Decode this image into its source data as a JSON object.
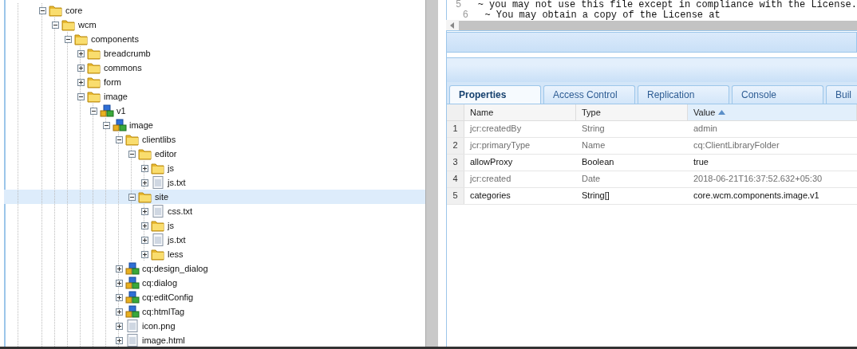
{
  "tree": [
    {
      "label": "core",
      "kind": "folder",
      "expanded": true,
      "selected": false,
      "children": [
        {
          "label": "wcm",
          "kind": "folder",
          "expanded": true,
          "selected": false,
          "children": [
            {
              "label": "components",
              "kind": "folder",
              "expanded": true,
              "selected": false,
              "children": [
                {
                  "label": "breadcrumb",
                  "kind": "folder",
                  "expanded": false,
                  "selected": false
                },
                {
                  "label": "commons",
                  "kind": "folder",
                  "expanded": false,
                  "selected": false
                },
                {
                  "label": "form",
                  "kind": "folder",
                  "expanded": false,
                  "selected": false
                },
                {
                  "label": "image",
                  "kind": "folder",
                  "expanded": true,
                  "selected": false,
                  "children": [
                    {
                      "label": "v1",
                      "kind": "component",
                      "expanded": true,
                      "selected": false,
                      "children": [
                        {
                          "label": "image",
                          "kind": "component",
                          "expanded": true,
                          "selected": false,
                          "children": [
                            {
                              "label": "clientlibs",
                              "kind": "folder",
                              "expanded": true,
                              "selected": false,
                              "children": [
                                {
                                  "label": "editor",
                                  "kind": "folder",
                                  "expanded": true,
                                  "selected": false,
                                  "children": [
                                    {
                                      "label": "js",
                                      "kind": "folder",
                                      "expanded": false,
                                      "selected": false
                                    },
                                    {
                                      "label": "js.txt",
                                      "kind": "file",
                                      "expanded": false,
                                      "selected": false
                                    }
                                  ]
                                },
                                {
                                  "label": "site",
                                  "kind": "folder",
                                  "expanded": true,
                                  "selected": true,
                                  "children": [
                                    {
                                      "label": "css.txt",
                                      "kind": "file",
                                      "expanded": false,
                                      "selected": false
                                    },
                                    {
                                      "label": "js",
                                      "kind": "folder",
                                      "expanded": false,
                                      "selected": false
                                    },
                                    {
                                      "label": "js.txt",
                                      "kind": "file",
                                      "expanded": false,
                                      "selected": false
                                    },
                                    {
                                      "label": "less",
                                      "kind": "folder",
                                      "expanded": false,
                                      "selected": false
                                    }
                                  ]
                                }
                              ]
                            },
                            {
                              "label": "cq:design_dialog",
                              "kind": "component",
                              "expanded": false,
                              "selected": false
                            },
                            {
                              "label": "cq:dialog",
                              "kind": "component",
                              "expanded": false,
                              "selected": false
                            },
                            {
                              "label": "cq:editConfig",
                              "kind": "component",
                              "expanded": false,
                              "selected": false
                            },
                            {
                              "label": "cq:htmlTag",
                              "kind": "component",
                              "expanded": false,
                              "selected": false
                            },
                            {
                              "label": "icon.png",
                              "kind": "file",
                              "expanded": false,
                              "selected": false
                            },
                            {
                              "label": "image.html",
                              "kind": "file",
                              "expanded": false,
                              "selected": false
                            }
                          ]
                        }
                      ]
                    }
                  ]
                }
              ]
            }
          ]
        }
      ]
    }
  ],
  "editor": {
    "lines": [
      {
        "number": "5",
        "text": "  ~ you may not use this file except in compliance with the License."
      },
      {
        "number": "6",
        "text": "  ~ You may obtain a copy of the License at"
      }
    ]
  },
  "tabs": [
    {
      "label": "Properties",
      "selected": true
    },
    {
      "label": "Access Control",
      "selected": false
    },
    {
      "label": "Replication",
      "selected": false
    },
    {
      "label": "Console",
      "selected": false
    },
    {
      "label": "Buil",
      "selected": false
    }
  ],
  "grid": {
    "columns": [
      {
        "label": "Name",
        "sorted": false
      },
      {
        "label": "Type",
        "sorted": false
      },
      {
        "label": "Value",
        "sorted": true
      }
    ],
    "rows": [
      {
        "number": "1",
        "name": "jcr:createdBy",
        "type": "String",
        "value": "admin",
        "protected": true
      },
      {
        "number": "2",
        "name": "jcr:primaryType",
        "type": "Name",
        "value": "cq:ClientLibraryFolder",
        "protected": true
      },
      {
        "number": "3",
        "name": "allowProxy",
        "type": "Boolean",
        "value": "true",
        "protected": false
      },
      {
        "number": "4",
        "name": "jcr:created",
        "type": "Date",
        "value": "2018-06-21T16:37:52.632+05:30",
        "protected": true
      },
      {
        "number": "5",
        "name": "categories",
        "type": "String[]",
        "value": "core.wcm.components.image.v1",
        "protected": false
      }
    ]
  }
}
